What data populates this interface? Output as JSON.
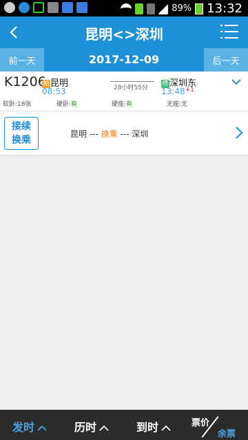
{
  "status_bar": {
    "battery": "89%",
    "time": "13:32"
  },
  "header": {
    "title": "昆明<>深圳"
  },
  "date_bar": {
    "prev_label": "前一天",
    "date": "2017-12-09",
    "next_label": "后一天"
  },
  "train": {
    "number": "K1206",
    "start_tag": "始",
    "from_station": "昆明",
    "depart_time": "08:53",
    "duration": "28小时55分",
    "end_tag": "终",
    "to_station": "深圳东",
    "arrive_time": "13:48",
    "day_offset": "+1",
    "seats": [
      {
        "name": "软卧:",
        "value": "18张"
      },
      {
        "name": "硬卧:",
        "value": "有"
      },
      {
        "name": "硬座:",
        "value": "有"
      },
      {
        "name": "无座:",
        "value": "无"
      }
    ]
  },
  "transfer": {
    "button_line1": "接续",
    "button_line2": "换乘",
    "from": "昆明",
    "sep1": " --- ",
    "middle": "换乘",
    "sep2": " --- ",
    "to": "深圳"
  },
  "bottom_bar": {
    "depart_sort": "发时",
    "duration_sort": "历时",
    "arrive_sort": "到时",
    "price_label": "票价",
    "remaining_label": "余票"
  },
  "colors": {
    "primary": "#1e90d6",
    "accent_orange": "#f08020",
    "available_green": "#2a9a2a"
  }
}
